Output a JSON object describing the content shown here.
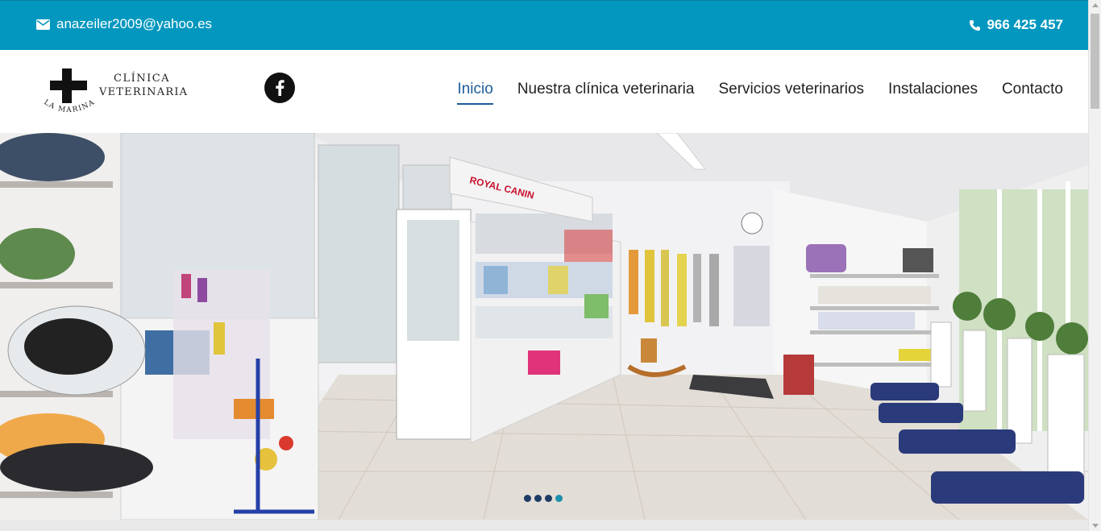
{
  "topbar": {
    "email": "anazeiler2009@yahoo.es",
    "email_icon": "envelope-icon",
    "phone": "966 425 457",
    "phone_icon": "phone-icon",
    "background": "#0197bf"
  },
  "logo": {
    "line1": "CLÍNICA",
    "line2": "VETERINARIA",
    "arc": "LA MARINA"
  },
  "social": {
    "facebook_icon": "facebook-icon"
  },
  "nav": {
    "items": [
      {
        "label": "Inicio",
        "active": true
      },
      {
        "label": "Nuestra clínica veterinaria",
        "active": false
      },
      {
        "label": "Servicios veterinarios",
        "active": false
      },
      {
        "label": "Instalaciones",
        "active": false
      },
      {
        "label": "Contacto",
        "active": false
      }
    ],
    "active_color": "#1b5c99"
  },
  "hero": {
    "shelf_sign": "ROYAL CANIN",
    "slides": 4,
    "current_slide": 4
  }
}
